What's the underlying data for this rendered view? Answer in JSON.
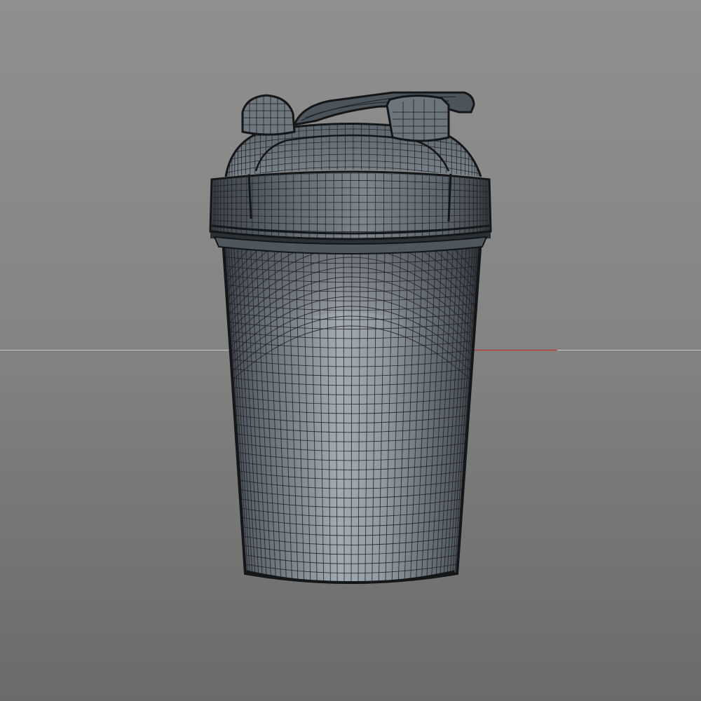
{
  "viewport": {
    "background_top": "#8f8f8f",
    "background_bottom": "#6b6b6b",
    "horizon_color": "#c4c4c4",
    "x_axis_color": "#c0392b"
  },
  "model": {
    "kind": "shaker-bottle-wireframe",
    "surface_color": "#7b838b",
    "surface_highlight": "#a3abb2",
    "wire_color": "#1d2024",
    "edge_color": "#141618",
    "cup_vertical_segments": 48,
    "cup_horizontal_rings": 36,
    "lid_vertical_segments": 52,
    "lid_horizontal_rings": 9
  }
}
